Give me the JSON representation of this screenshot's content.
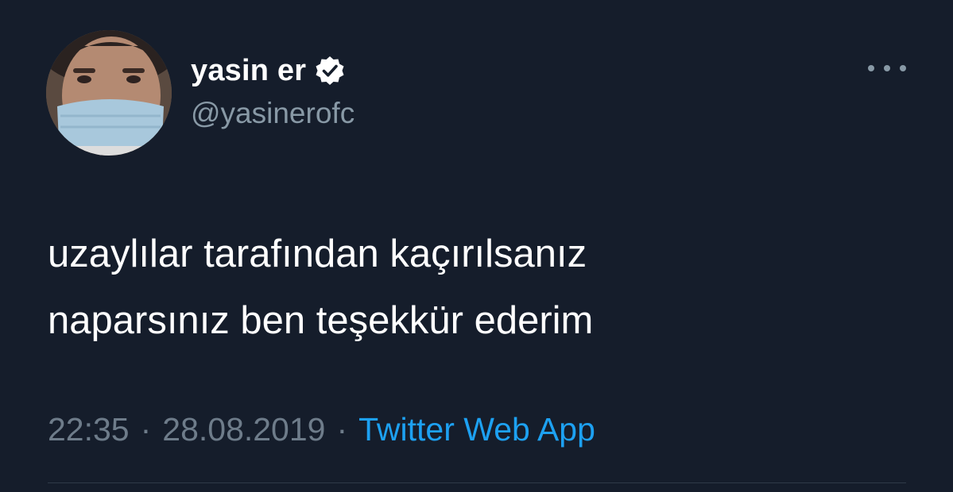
{
  "author": {
    "display_name": "yasin er",
    "handle": "@yasinerofc",
    "verified": true,
    "avatar_icon": "profile-photo-masked-man"
  },
  "tweet": {
    "line1": "uzaylılar tarafından kaçırılsanız",
    "line2": "naparsınız ben teşekkür ederim"
  },
  "meta": {
    "time": "22:35",
    "separator": "·",
    "date": "28.08.2019",
    "source": "Twitter Web App"
  },
  "more_menu_icon": "ellipsis-icon",
  "colors": {
    "background": "#151d2b",
    "text": "#ffffff",
    "muted": "#8899a6",
    "link": "#1da1f2"
  }
}
